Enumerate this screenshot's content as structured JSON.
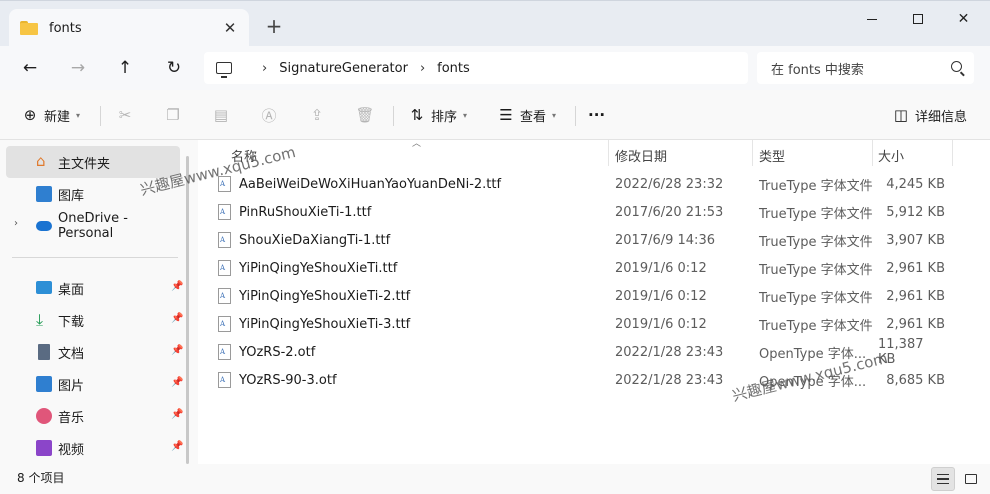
{
  "window": {
    "tab_title": "fonts",
    "new_tab_label": "+",
    "minimize_label": "",
    "maximize_label": "",
    "close_label": "✕"
  },
  "address": {
    "crumbs": [
      "SignatureGenerator",
      "fonts"
    ],
    "search_placeholder": "在 fonts 中搜索"
  },
  "toolbar": {
    "new_label": "新建",
    "sort_label": "排序",
    "view_label": "查看",
    "more_label": "···",
    "details_label": "详细信息"
  },
  "sidebar": {
    "items": [
      {
        "label": "主文件夹",
        "icon": "home-icon",
        "pinned": false,
        "active": true
      },
      {
        "label": "图库",
        "icon": "gallery-icon",
        "pinned": false
      },
      {
        "label": "OneDrive - Personal",
        "icon": "cloud-icon",
        "pinned": false,
        "expandable": true
      },
      {
        "label": "桌面",
        "icon": "desktop-icon",
        "pinned": true
      },
      {
        "label": "下载",
        "icon": "download-icon",
        "pinned": true
      },
      {
        "label": "文档",
        "icon": "document-icon",
        "pinned": true
      },
      {
        "label": "图片",
        "icon": "pictures-icon",
        "pinned": true
      },
      {
        "label": "音乐",
        "icon": "music-icon",
        "pinned": true
      },
      {
        "label": "视频",
        "icon": "video-icon",
        "pinned": true
      }
    ]
  },
  "columns": {
    "name": "名称",
    "date": "修改日期",
    "type": "类型",
    "size": "大小"
  },
  "files": [
    {
      "name": "AaBeiWeiDeWoXiHuanYaoYuanDeNi-2.ttf",
      "date": "2022/6/28 23:32",
      "type": "TrueType 字体文件",
      "size": "4,245 KB"
    },
    {
      "name": "PinRuShouXieTi-1.ttf",
      "date": "2017/6/20 21:53",
      "type": "TrueType 字体文件",
      "size": "5,912 KB"
    },
    {
      "name": "ShouXieDaXiangTi-1.ttf",
      "date": "2017/6/9 14:36",
      "type": "TrueType 字体文件",
      "size": "3,907 KB"
    },
    {
      "name": "YiPinQingYeShouXieTi.ttf",
      "date": "2019/1/6 0:12",
      "type": "TrueType 字体文件",
      "size": "2,961 KB"
    },
    {
      "name": "YiPinQingYeShouXieTi-2.ttf",
      "date": "2019/1/6 0:12",
      "type": "TrueType 字体文件",
      "size": "2,961 KB"
    },
    {
      "name": "YiPinQingYeShouXieTi-3.ttf",
      "date": "2019/1/6 0:12",
      "type": "TrueType 字体文件",
      "size": "2,961 KB"
    },
    {
      "name": "YOzRS-2.otf",
      "date": "2022/1/28 23:43",
      "type": "OpenType 字体...",
      "size": "11,387 KB"
    },
    {
      "name": "YOzRS-90-3.otf",
      "date": "2022/1/28 23:43",
      "type": "OpenType 字体...",
      "size": "8,685 KB"
    }
  ],
  "watermark": "兴趣屋www.xqu5.com",
  "status": {
    "item_count": "8 个项目"
  },
  "colors": {
    "accent": "#0067c0",
    "selected_sidebar": "#e2e2e2",
    "folder": "#f7c544"
  }
}
